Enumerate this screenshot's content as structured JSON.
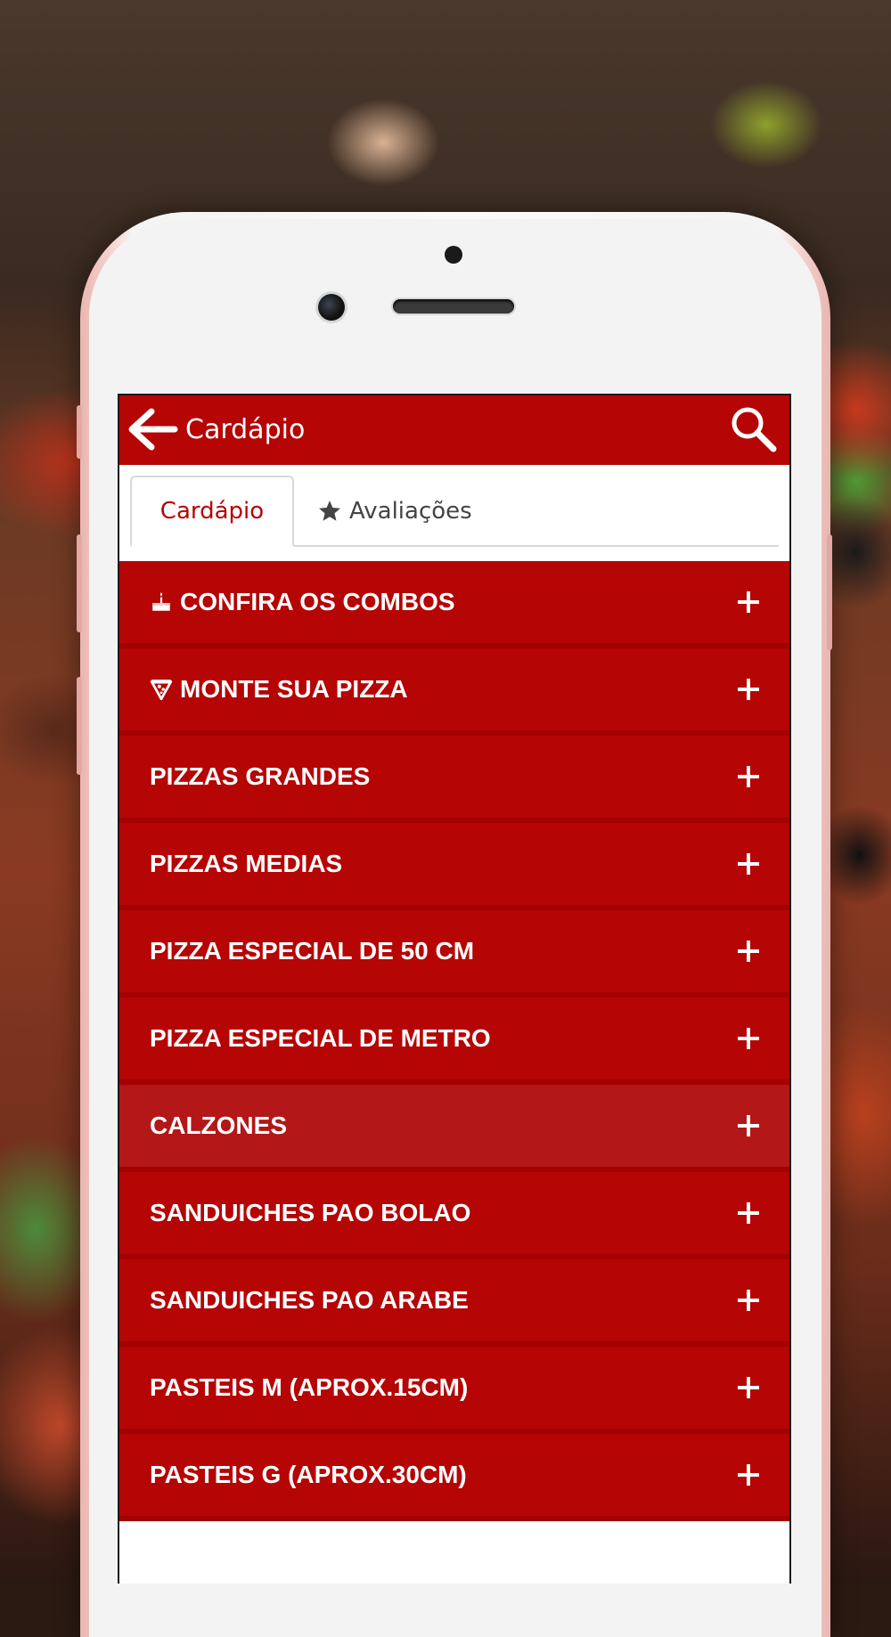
{
  "appbar": {
    "title": "Cardápio"
  },
  "tabs": [
    {
      "label": "Cardápio",
      "active": true
    },
    {
      "label": "Avaliações",
      "active": false,
      "icon": "star-icon"
    }
  ],
  "menu": {
    "items": [
      {
        "label": "CONFIRA OS COMBOS",
        "icon": "cake-icon"
      },
      {
        "label": "MONTE SUA PIZZA",
        "icon": "pizza-slice-icon"
      },
      {
        "label": "PIZZAS GRANDES"
      },
      {
        "label": "PIZZAS MEDIAS"
      },
      {
        "label": "PIZZA ESPECIAL DE 50 CM"
      },
      {
        "label": "PIZZA ESPECIAL DE METRO"
      },
      {
        "label": "CALZONES",
        "highlighted": true
      },
      {
        "label": "SANDUICHES PAO BOLAO"
      },
      {
        "label": "SANDUICHES PAO ARABE"
      },
      {
        "label": "PASTEIS M (APROX.15CM)"
      },
      {
        "label": "PASTEIS G (APROX.30CM)"
      }
    ]
  },
  "colors": {
    "brand_red": "#b50505",
    "highlight_red": "#b31717",
    "tab_active_text": "#b50505",
    "phone_rose": "#e9b6b1"
  }
}
